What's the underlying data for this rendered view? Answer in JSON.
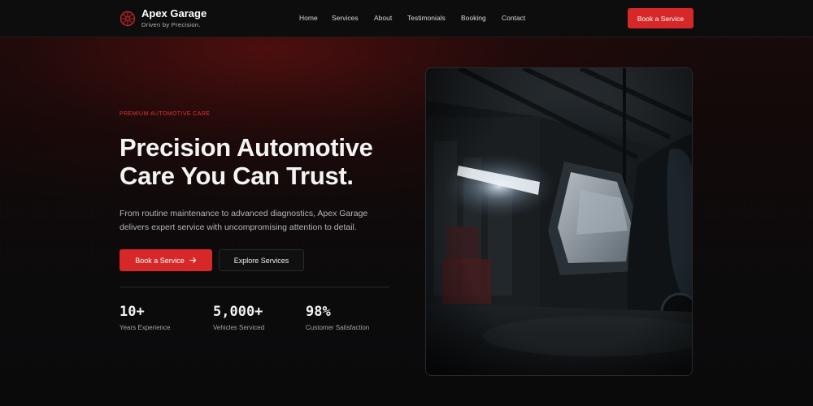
{
  "brand": {
    "name": "Apex Garage",
    "tagline": "Driven by Precision."
  },
  "nav": {
    "links": [
      "Home",
      "Services",
      "About",
      "Testimonials",
      "Booking",
      "Contact"
    ],
    "cta_label": "Book a Service"
  },
  "hero": {
    "eyebrow": "PREMIUM AUTOMOTIVE CARE",
    "title": "Precision Automotive Care You Can Trust.",
    "description": "From routine maintenance to advanced diagnostics, Apex Garage delivers expert service with uncompromising attention to detail.",
    "primary_button": "Book a Service",
    "secondary_button": "Explore Services",
    "stats": [
      {
        "value": "10+",
        "label": "Years Experience"
      },
      {
        "value": "5,000+",
        "label": "Vehicles Serviced"
      },
      {
        "value": "98%",
        "label": "Customer Satisfaction"
      }
    ]
  },
  "colors": {
    "accent": "#d62828",
    "background": "#0b0b0c"
  },
  "icons": {
    "brand_logo": "wheel-icon",
    "button_arrow": "arrow-right-icon"
  }
}
